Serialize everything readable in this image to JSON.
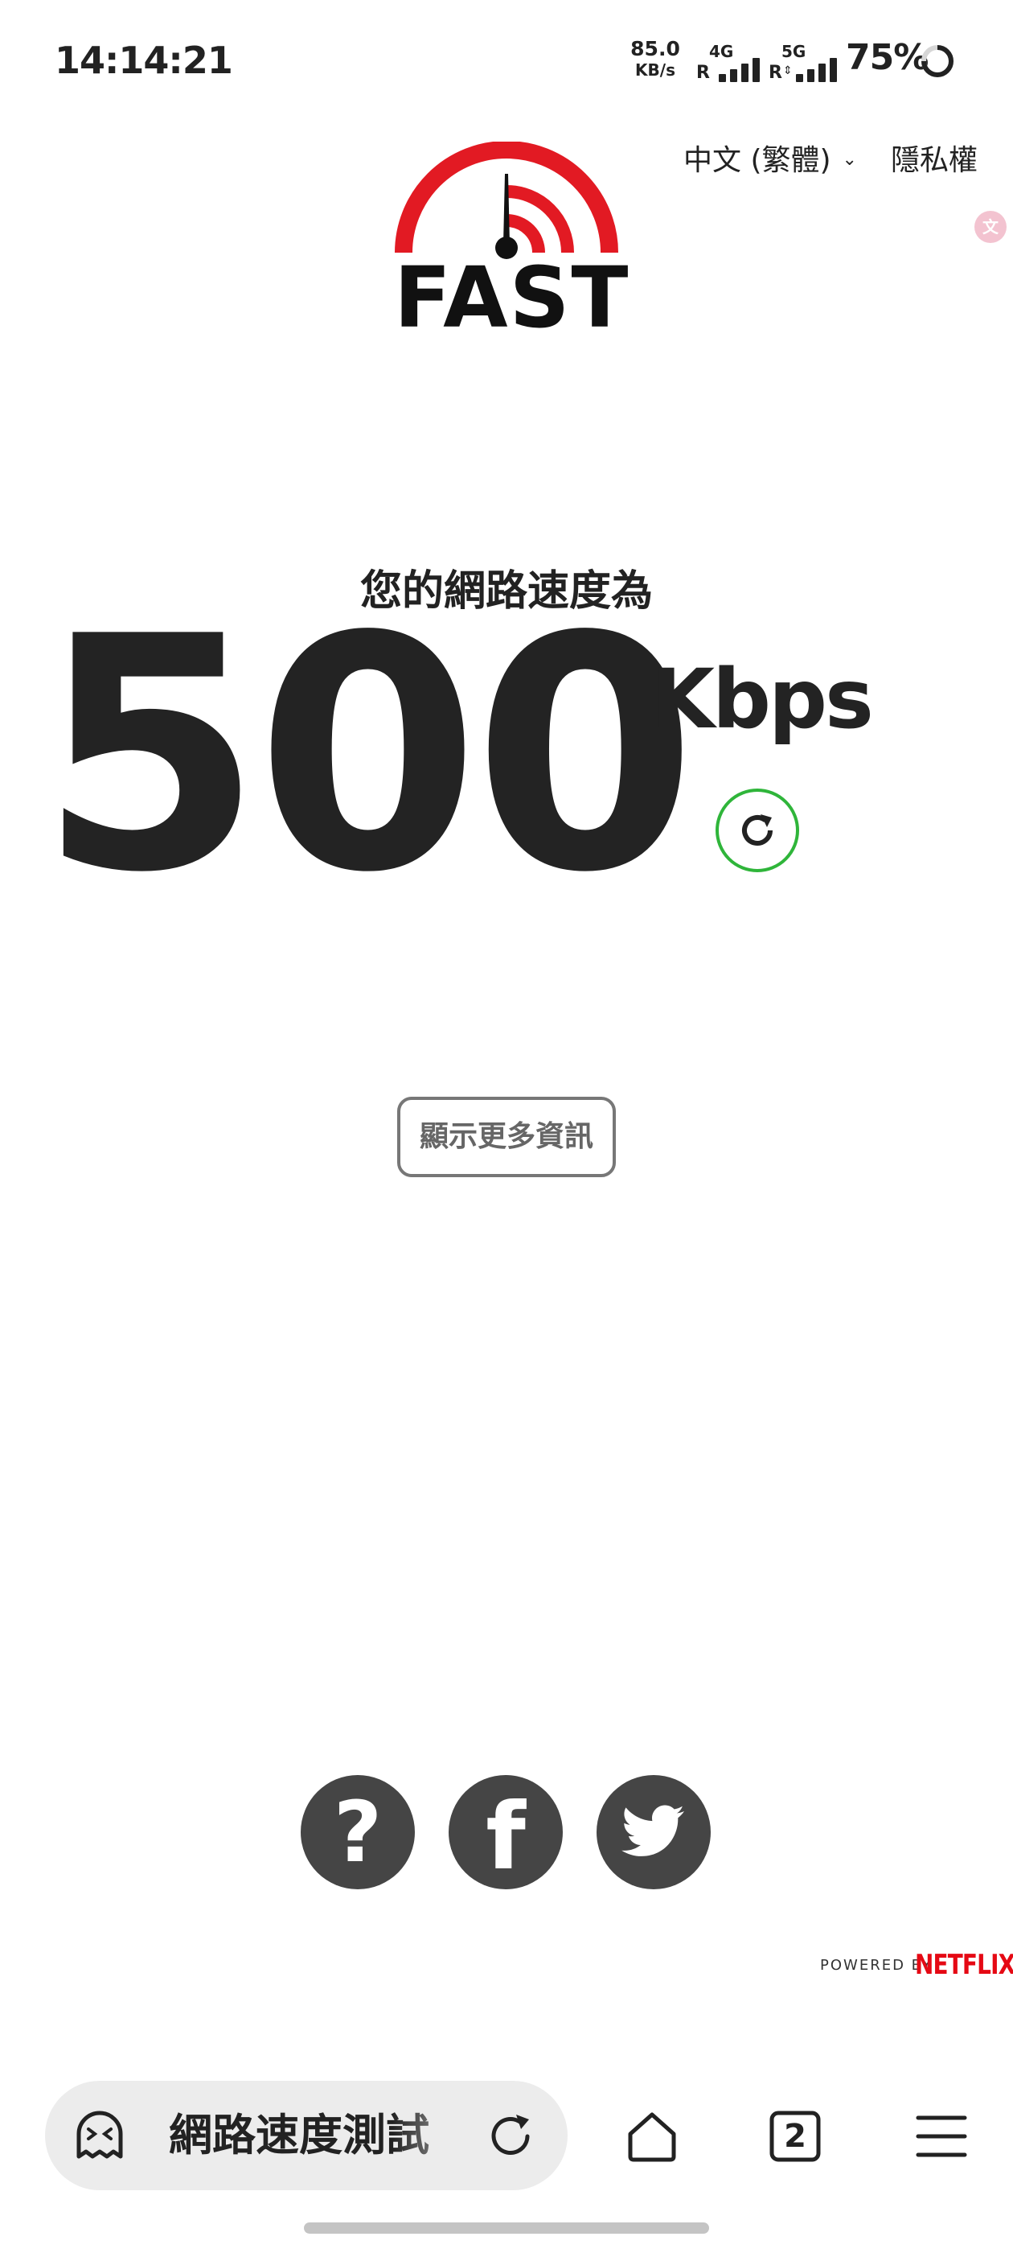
{
  "status_bar": {
    "time": "14:14:21",
    "net_speed_value": "85.0",
    "net_speed_unit": "KB/s",
    "signal_1_type": "4G",
    "signal_1_roaming": "R",
    "signal_2_type": "5G",
    "signal_2_roaming": "R",
    "battery": "75%"
  },
  "header": {
    "language": "中文 (繁體)",
    "privacy": "隱私權"
  },
  "logo": {
    "text": "FAST",
    "color_red": "#e21a23"
  },
  "speed": {
    "label": "您的網路速度為",
    "value": "500",
    "unit": "Kbps",
    "refresh_color": "#2fb53a"
  },
  "more_info_button": "顯示更多資訊",
  "social": {
    "help_glyph": "?",
    "facebook_glyph": "f"
  },
  "footer": {
    "powered_by": "POWERED BY",
    "brand": "NETFLIX",
    "brand_color": "#e50914"
  },
  "browser_bar": {
    "url_title": "網路速度測試",
    "tab_count": "2"
  }
}
